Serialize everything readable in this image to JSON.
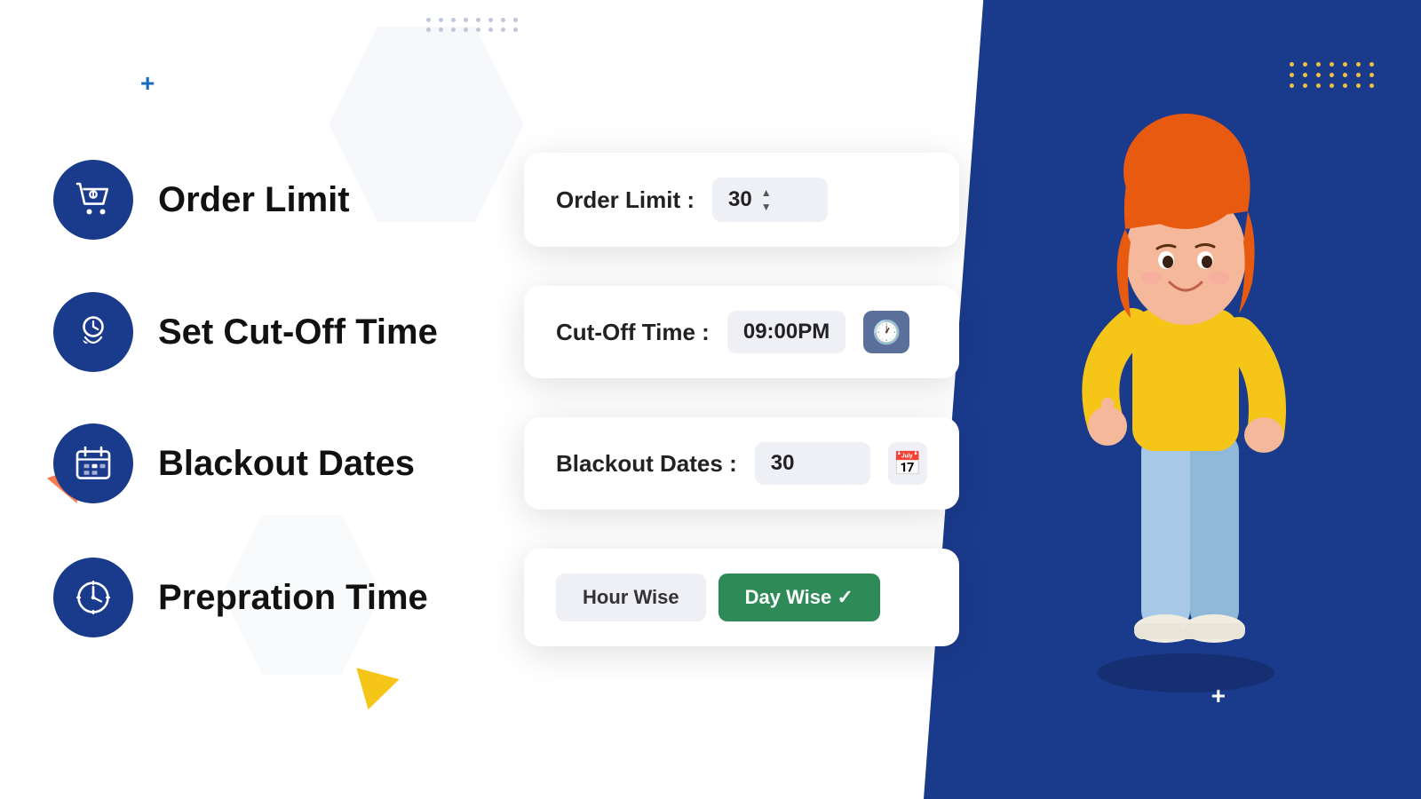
{
  "colors": {
    "primary_blue": "#1a3a8c",
    "green": "#2e8b57",
    "accent_orange": "#f97c4e",
    "accent_yellow": "#f5c518",
    "bg_input": "#eef0f5",
    "clock_bg": "#5a6f99"
  },
  "decorative": {
    "plus_top_left": "+",
    "plus_bottom_right": "+",
    "dots_count_top": 16,
    "dots_count_right": 21
  },
  "features": [
    {
      "id": "order-limit",
      "title": "Order Limit",
      "icon": "cart-icon",
      "control": {
        "label": "Order Limit :",
        "value": "30",
        "input_type": "spinner"
      }
    },
    {
      "id": "cut-off-time",
      "title": "Set Cut-Off Time",
      "icon": "clock-hand-icon",
      "control": {
        "label": "Cut-Off Time :",
        "value": "09:00PM",
        "input_type": "time"
      }
    },
    {
      "id": "blackout-dates",
      "title": "Blackout Dates",
      "icon": "calendar-icon",
      "control": {
        "label": "Blackout Dates :",
        "value": "30",
        "input_type": "calendar"
      }
    },
    {
      "id": "preparation-time",
      "title": "Prepration Time",
      "icon": "clock-icon",
      "control": {
        "label": null,
        "input_type": "toggle",
        "options": [
          {
            "label": "Hour Wise",
            "active": false
          },
          {
            "label": "Day Wise ✓",
            "active": true
          }
        ]
      }
    }
  ]
}
